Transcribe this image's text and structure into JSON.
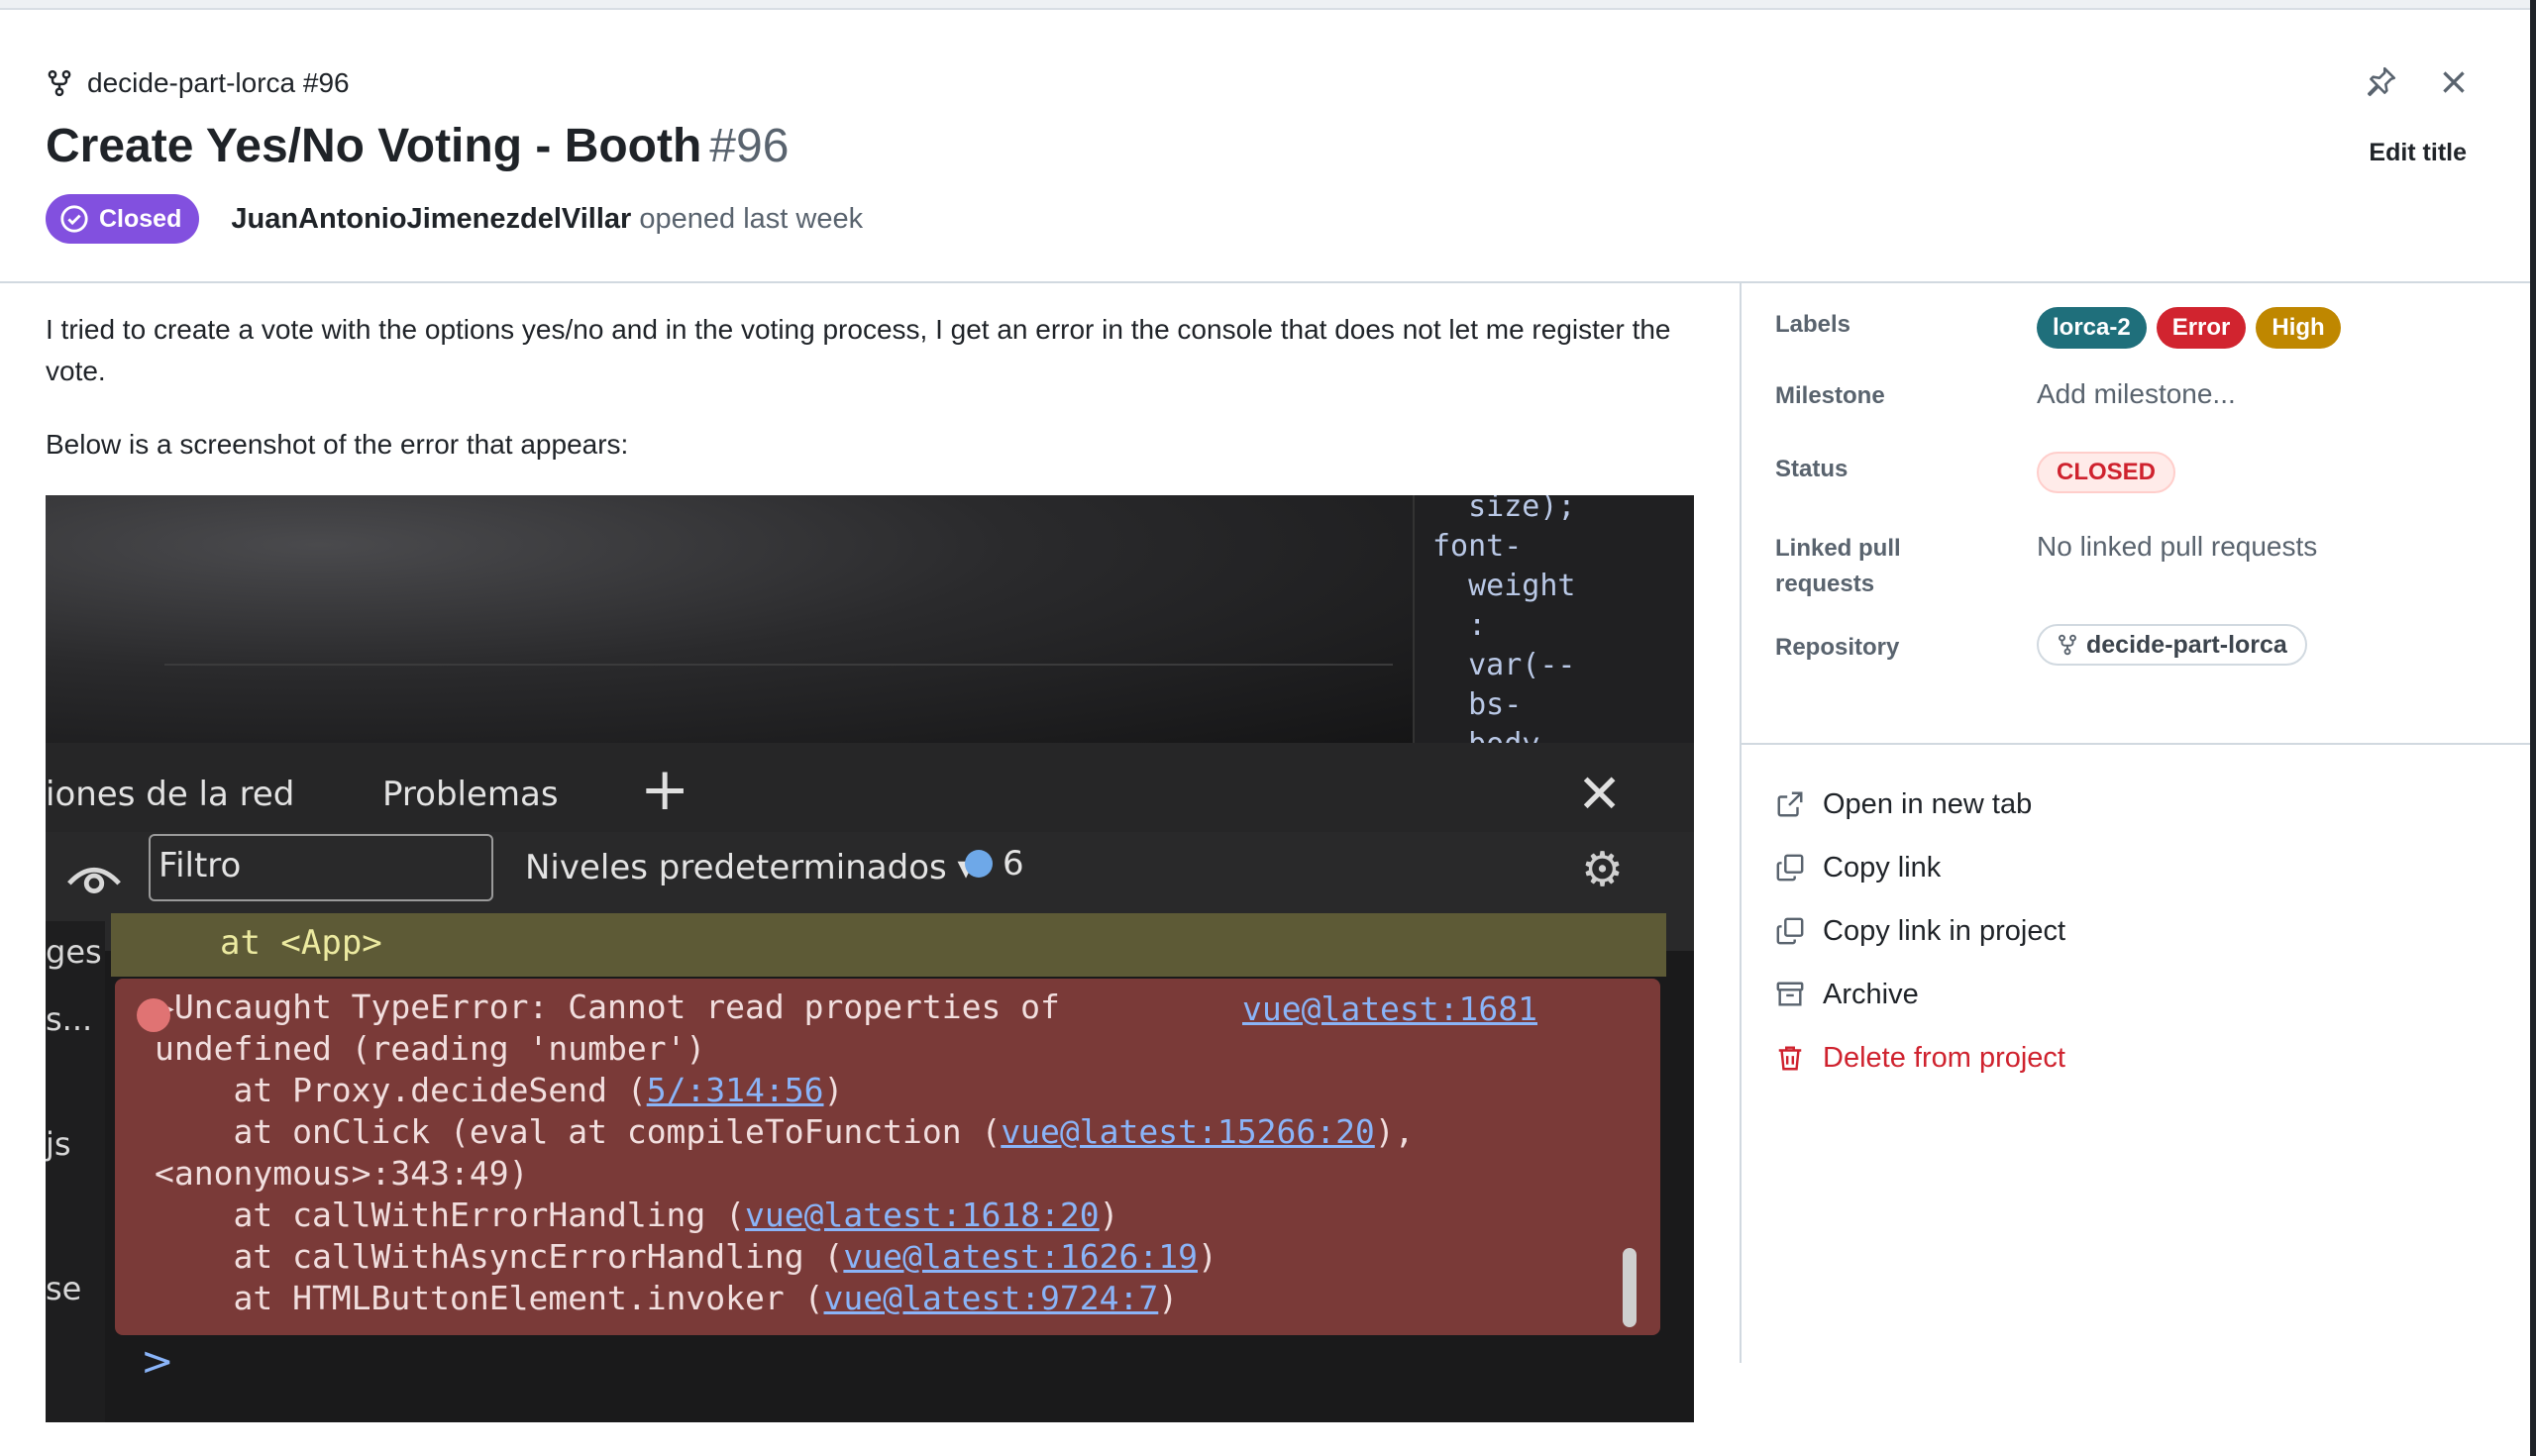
{
  "header": {
    "breadcrumb": "decide-part-lorca #96",
    "title": "Create Yes/No Voting - Booth",
    "number": "#96",
    "edit_title": "Edit title",
    "status_badge": "Closed",
    "author": "JuanAntonioJimenezdelVillar",
    "opened_text": "opened last week"
  },
  "body": {
    "paragraph_1": "I tried to create a vote with the options yes/no and in the voting process, I get an error in the console that does not let me register the vote.",
    "paragraph_2": "Below is a screenshot of the error that appears:"
  },
  "screenshot": {
    "css_code": "  size);\nfont-\n  weight\n  :\n  var(--\n  bs-\n  body-",
    "tab_network": "iones de la red",
    "tab_problems": "Problemas",
    "filter_placeholder": "Filtro",
    "levels": "Niveles predeterminados ▾",
    "message_count": "6",
    "side_1": "ges",
    "side_2": "s...",
    "side_3": "js",
    "side_4": "se",
    "app_line": "at <App>",
    "error_link": "vue@latest:1681",
    "err_1": "▶Uncaught TypeError: Cannot read properties of",
    "err_2": "undefined (reading 'number')",
    "err_3a": "    at Proxy.decideSend (",
    "err_3l": "5/:314:56",
    "err_4a": "    at onClick (eval at compileToFunction (",
    "err_4l": "vue@latest:15266:20",
    "err_5": "<anonymous>:343:49)",
    "err_6a": "    at callWithErrorHandling (",
    "err_6l": "vue@latest:1618:20",
    "err_7a": "    at callWithAsyncErrorHandling (",
    "err_7l": "vue@latest:1626:19",
    "err_8a": "    at HTMLButtonElement.invoker (",
    "err_8l": "vue@latest:9724:7",
    "prompt": ">"
  },
  "sidebar": {
    "labels_title": "Labels",
    "labels": [
      {
        "name": "lorca-2",
        "color": "#1f6f7b"
      },
      {
        "name": "Error",
        "color": "#d1242f"
      },
      {
        "name": "High",
        "color": "#bf8700"
      }
    ],
    "milestone_title": "Milestone",
    "milestone_value": "Add milestone...",
    "status_title": "Status",
    "status_value": "CLOSED",
    "linked_title": "Linked pull requests",
    "linked_value": "No linked pull requests",
    "repo_title": "Repository",
    "repo_value": "decide-part-lorca"
  },
  "actions": {
    "open_new_tab": "Open in new tab",
    "copy_link": "Copy link",
    "copy_link_project": "Copy link in project",
    "archive": "Archive",
    "delete": "Delete from project"
  },
  "colors": {
    "closed_purple": "#8250df",
    "danger_red": "#cf222e"
  }
}
